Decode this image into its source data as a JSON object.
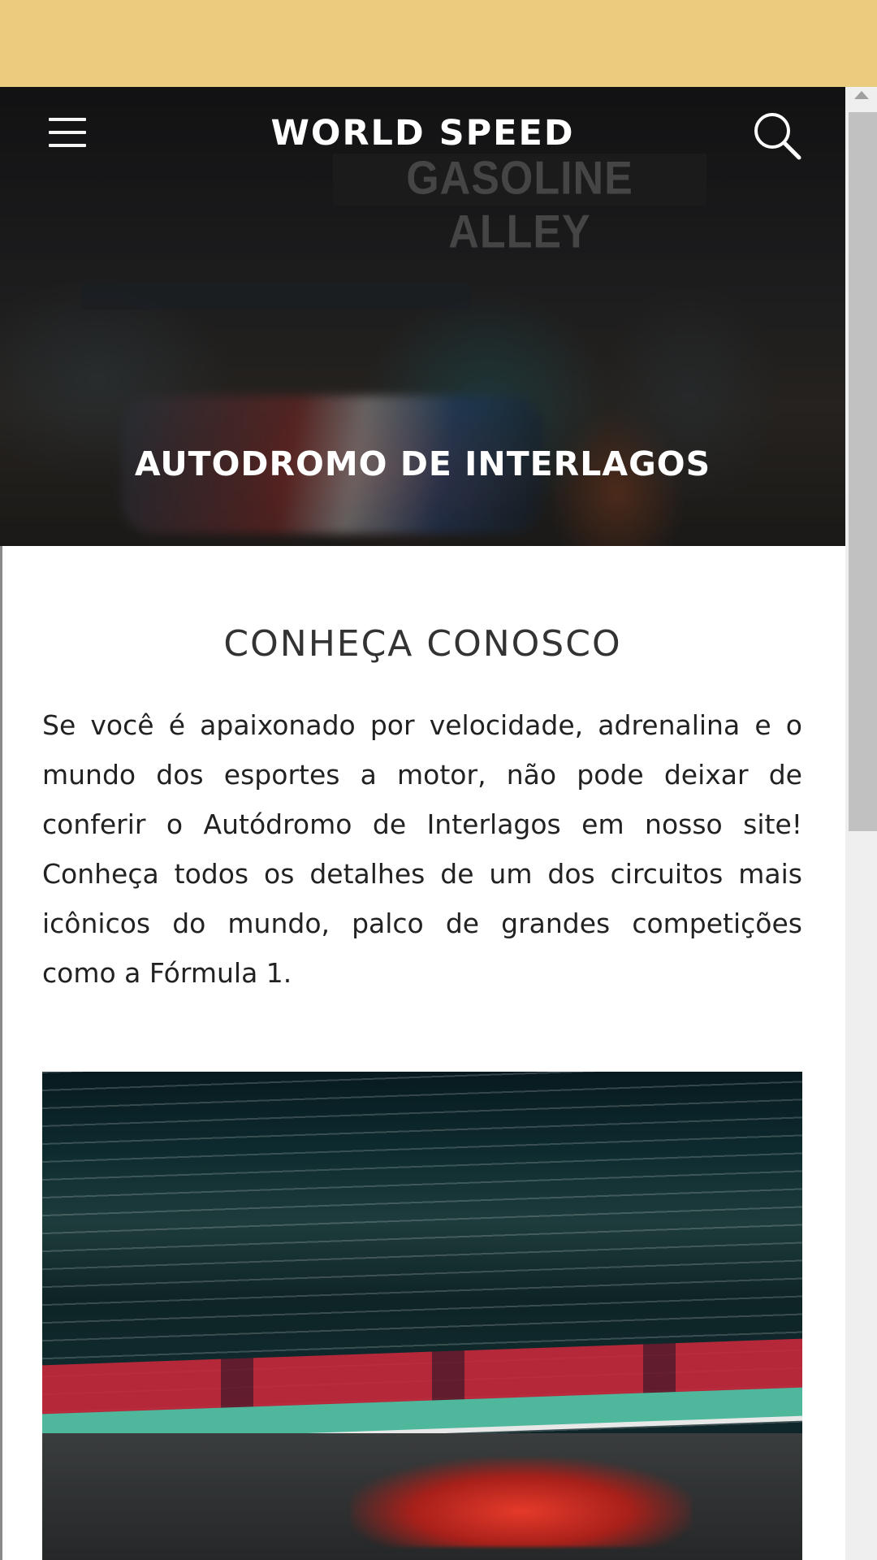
{
  "header": {
    "brand": "WORLD SPEED",
    "menu_icon": "hamburger-menu-icon",
    "search_icon": "search-icon"
  },
  "hero": {
    "title": "AUTODROMO DE INTERLAGOS",
    "background_sign_text": "GASOLINE ALLEY"
  },
  "section": {
    "title": "CONHEÇA CONOSCO",
    "paragraph": "Se você é apaixonado por velocidade, adrenalina e o mundo dos esportes a motor, não pode deixar de conferir o Autódromo de Interlagos em nosso site! Conheça todos os detalhes de um dos circuitos mais icônicos do mundo, palco de grandes competições como a Fórmula 1."
  },
  "colors": {
    "topbar": "#ebcb7d",
    "hero_text": "#ffffff",
    "body_text": "#222222"
  }
}
